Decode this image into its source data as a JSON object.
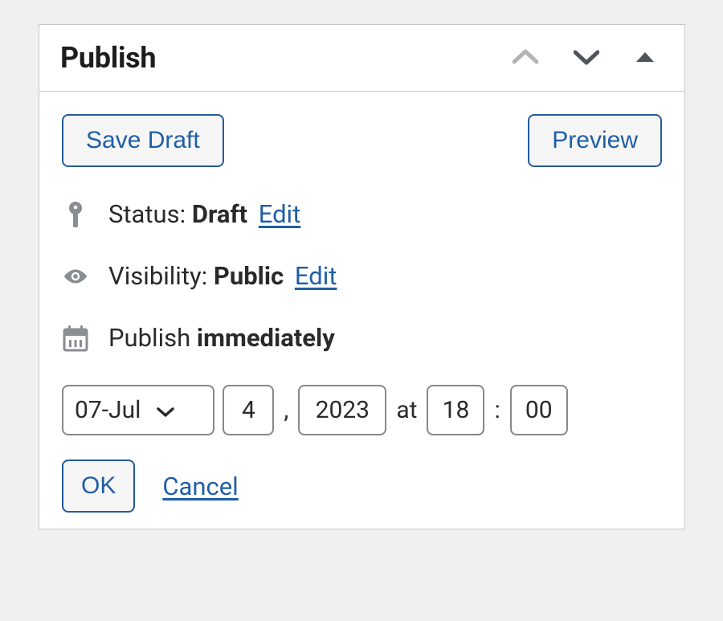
{
  "panel": {
    "title": "Publish",
    "buttons": {
      "save_draft": "Save Draft",
      "preview": "Preview"
    },
    "status": {
      "label": "Status:",
      "value": "Draft",
      "edit": "Edit"
    },
    "visibility": {
      "label": "Visibility:",
      "value": "Public",
      "edit": "Edit"
    },
    "publish": {
      "label": "Publish",
      "value": "immediately"
    },
    "date": {
      "month": "07-Jul",
      "day": "4",
      "year": "2023",
      "at": "at",
      "hour": "18",
      "minute": "00",
      "comma": ",",
      "colon": ":"
    },
    "actions": {
      "ok": "OK",
      "cancel": "Cancel"
    }
  }
}
